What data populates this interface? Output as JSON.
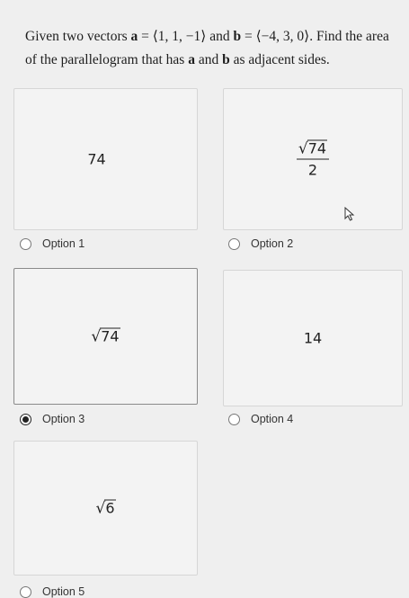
{
  "question": {
    "prefix": "Given two vectors ",
    "a_name": "a",
    "a_eq": " = ⟨1, 1, −1⟩",
    "and": " and ",
    "b_name": "b",
    "b_eq": " = ⟨−4, 3, 0⟩",
    "suffix_1": ". Find the area of the parallelogram that has ",
    "a_name2": "a",
    "and2": " and ",
    "b_name2": "b",
    "suffix_2": " as adjacent sides."
  },
  "options": [
    {
      "label": "Option 1",
      "answer": "74",
      "selected": false
    },
    {
      "label": "Option 2",
      "answer_radicand": "74",
      "answer_den": "2",
      "selected": false
    },
    {
      "label": "Option 3",
      "answer_radicand": "74",
      "selected": true
    },
    {
      "label": "Option 4",
      "answer": "14",
      "selected": false
    },
    {
      "label": "Option 5",
      "answer_radicand": "6",
      "selected": false
    }
  ]
}
